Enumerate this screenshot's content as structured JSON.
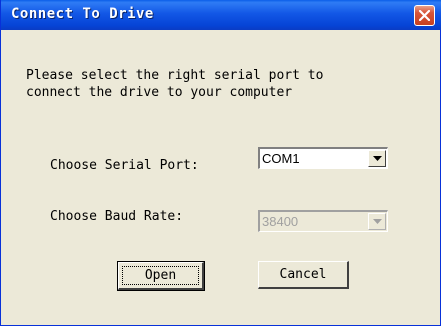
{
  "dialog": {
    "title": "Connect To Drive",
    "message": "Please select the right serial port to\nconnect the drive to your computer",
    "close_icon": "close-icon"
  },
  "serial_port": {
    "label": "Choose Serial Port:",
    "value": "COM1"
  },
  "baud_rate": {
    "label": "Choose Baud Rate:",
    "value": "38400"
  },
  "buttons": {
    "open": "Open",
    "cancel": "Cancel"
  }
}
